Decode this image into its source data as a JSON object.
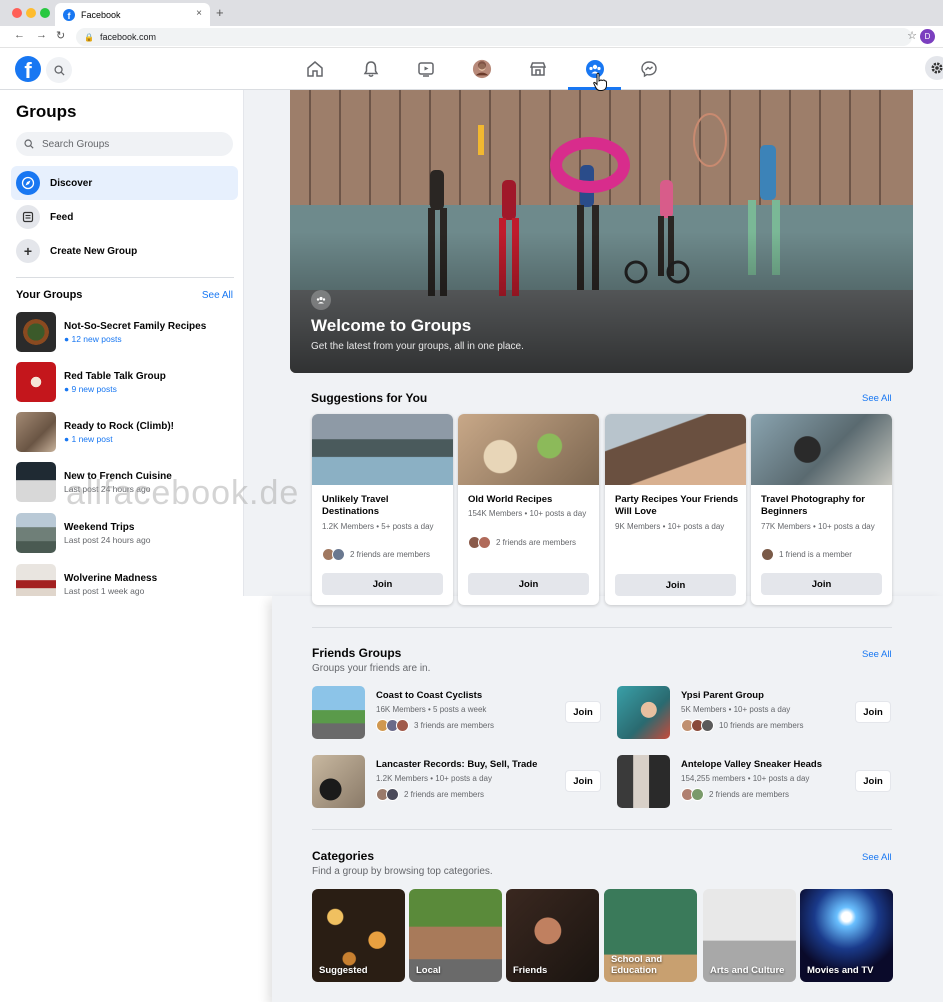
{
  "browser": {
    "tab_title": "Facebook",
    "url": "facebook.com",
    "profile_initial": "D",
    "new_tab": "+",
    "close_tab": "×"
  },
  "sidebar": {
    "title": "Groups",
    "search_placeholder": "Search Groups",
    "items": [
      {
        "label": "Discover",
        "icon": "compass-icon"
      },
      {
        "label": "Feed",
        "icon": "feed-icon"
      },
      {
        "label": "Create New Group",
        "icon": "plus-icon"
      }
    ],
    "your_groups_title": "Your Groups",
    "see_all": "See All",
    "groups": [
      {
        "name": "Not-So-Secret Family Recipes",
        "sub": "● 12 new posts",
        "highlight": true
      },
      {
        "name": "Red Table Talk Group",
        "sub": "● 9 new posts",
        "highlight": true
      },
      {
        "name": "Ready to Rock (Climb)!",
        "sub": "● 1 new post",
        "highlight": true
      },
      {
        "name": "New to French Cuisine",
        "sub": "Last post 24 hours ago",
        "highlight": false
      },
      {
        "name": "Weekend Trips",
        "sub": "Last post 24 hours ago",
        "highlight": false
      },
      {
        "name": "Wolverine Madness",
        "sub": "Last post 1 week ago",
        "highlight": false
      }
    ]
  },
  "hero": {
    "title": "Welcome to Groups",
    "subtitle": "Get the latest from your groups, all in one place."
  },
  "suggestions": {
    "title": "Suggestions for You",
    "see_all": "See All",
    "cards": [
      {
        "name": "Unlikely Travel Destinations",
        "meta": "1.2K Members • 5+ posts a day",
        "friends": "2 friends are members",
        "join": "Join"
      },
      {
        "name": "Old World Recipes",
        "meta": "154K Members • 10+ posts a day",
        "friends": "2 friends are members",
        "join": "Join"
      },
      {
        "name": "Party Recipes Your Friends Will Love",
        "meta": "9K Members • 10+ posts a day",
        "friends": "",
        "join": "Join"
      },
      {
        "name": "Travel Photography for Beginners",
        "meta": "77K Members • 10+ posts a day",
        "friends": "1 friend is a member",
        "join": "Join"
      }
    ]
  },
  "friends_groups": {
    "title": "Friends Groups",
    "subtitle": "Groups your friends are in.",
    "see_all": "See All",
    "items": [
      {
        "name": "Coast to Coast Cyclists",
        "meta": "16K Members • 5 posts a week",
        "friends": "3 friends are members",
        "join": "Join"
      },
      {
        "name": "Ypsi Parent Group",
        "meta": "5K Members • 10+ posts a day",
        "friends": "10 friends are members",
        "join": "Join"
      },
      {
        "name": "Lancaster Records: Buy, Sell, Trade",
        "meta": "1.2K Members • 10+ posts a day",
        "friends": "2 friends are members",
        "join": "Join"
      },
      {
        "name": "Antelope Valley Sneaker Heads",
        "meta": "154,255 members • 10+ posts a day",
        "friends": "2 friends are members",
        "join": "Join"
      }
    ]
  },
  "categories": {
    "title": "Categories",
    "subtitle": "Find a group by browsing top categories.",
    "see_all": "See All",
    "items": [
      {
        "label": "Suggested"
      },
      {
        "label": "Local"
      },
      {
        "label": "Friends"
      },
      {
        "label": "School and Education"
      },
      {
        "label": "Arts and Culture"
      },
      {
        "label": "Movies and TV"
      }
    ]
  },
  "watermark": "allfacebook.de",
  "colors": {
    "brand": "#1877f2",
    "background": "#f0f2f5"
  }
}
